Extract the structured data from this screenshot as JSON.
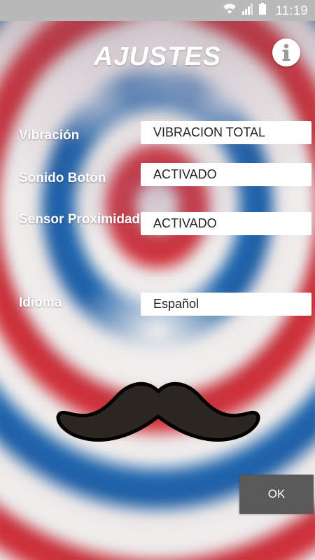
{
  "status_bar": {
    "time": "11:19",
    "icons": [
      "wifi-icon",
      "signal-icon",
      "battery-icon"
    ]
  },
  "header": {
    "title": "AJUSTES",
    "info_icon": "info-icon"
  },
  "settings": [
    {
      "label": "Vibración",
      "value": "VIBRACION TOTAL"
    },
    {
      "label": "Sonido Botón",
      "value": "ACTIVADO"
    },
    {
      "label": "Sensor Proximidad",
      "value": "ACTIVADO"
    },
    {
      "label": "Idioma",
      "value": "Español"
    }
  ],
  "footer": {
    "ok_label": "OK"
  },
  "decoration": {
    "image": "mustache-icon",
    "background": [
      "#c7303a",
      "#f1efee",
      "#2166ad"
    ]
  }
}
